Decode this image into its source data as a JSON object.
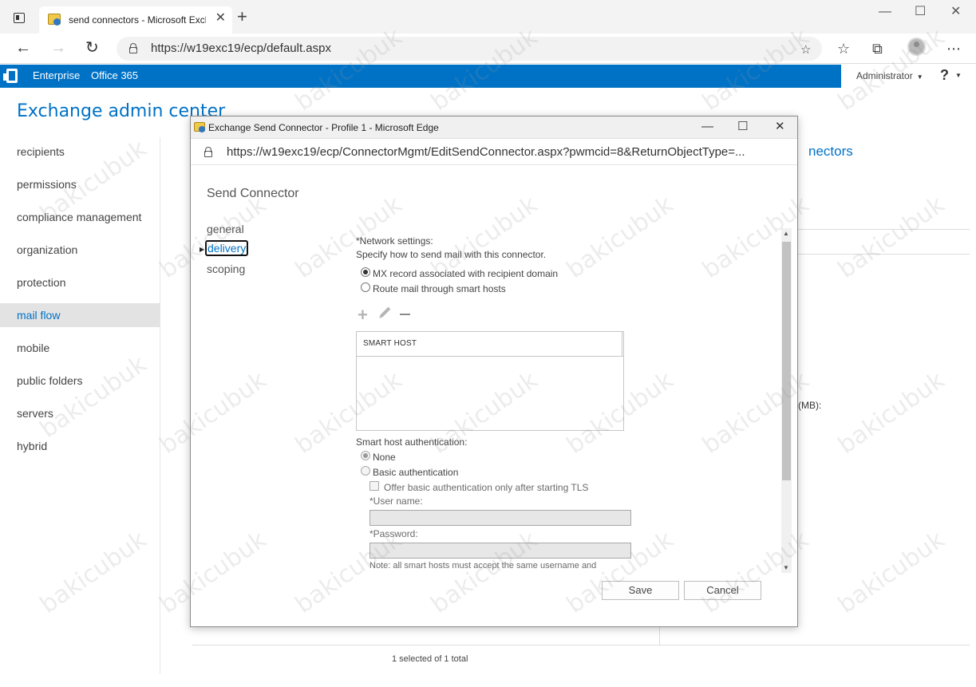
{
  "browser": {
    "tab_title": "send connectors - Microsoft Excl",
    "tab_close": "✕",
    "new_tab": "+",
    "address": "https://w19exc19/ecp/default.aspx",
    "minimize": "—",
    "maximize": "☐",
    "close": "✕"
  },
  "eac": {
    "nav_top": [
      "Enterprise",
      "Office 365"
    ],
    "admin": "Administrator",
    "help": "?",
    "title": "Exchange admin center",
    "sidebar": [
      {
        "label": "recipients"
      },
      {
        "label": "permissions"
      },
      {
        "label": "compliance management"
      },
      {
        "label": "organization"
      },
      {
        "label": "protection"
      },
      {
        "label": "mail flow",
        "active": true
      },
      {
        "label": "mobile"
      },
      {
        "label": "public folders"
      },
      {
        "label": "servers"
      },
      {
        "label": "hybrid"
      }
    ],
    "background_heading": "nectors",
    "background_mb_label": "(MB):",
    "status": "1 selected of 1 total"
  },
  "popup": {
    "window_title": "Exchange Send Connector - Profile 1 - Microsoft Edge",
    "url": "https://w19exc19/ecp/ConnectorMgmt/EditSendConnector.aspx?pwmcid=8&ReturnObjectType=...",
    "heading": "Send Connector",
    "nav": [
      "general",
      "delivery",
      "scoping"
    ],
    "active_nav": "delivery",
    "network_settings_label": "*Network settings:",
    "network_settings_help": "Specify how to send mail with this connector.",
    "radio_mx": "MX record associated with recipient domain",
    "radio_smart": "Route mail through smart hosts",
    "add_icon": "+",
    "smart_host_column": "SMART HOST",
    "auth_label": "Smart host authentication:",
    "auth_none": "None",
    "auth_basic": "Basic authentication",
    "offer_tls": "Offer basic authentication only after starting TLS",
    "username_label": "*User name:",
    "password_label": "*Password:",
    "note": "Note: all smart hosts must accept the same username and",
    "save": "Save",
    "cancel": "Cancel"
  },
  "watermark": "bakicubuk",
  "colors": {
    "accent": "#0072c6",
    "header_bar": "#0072c6"
  }
}
